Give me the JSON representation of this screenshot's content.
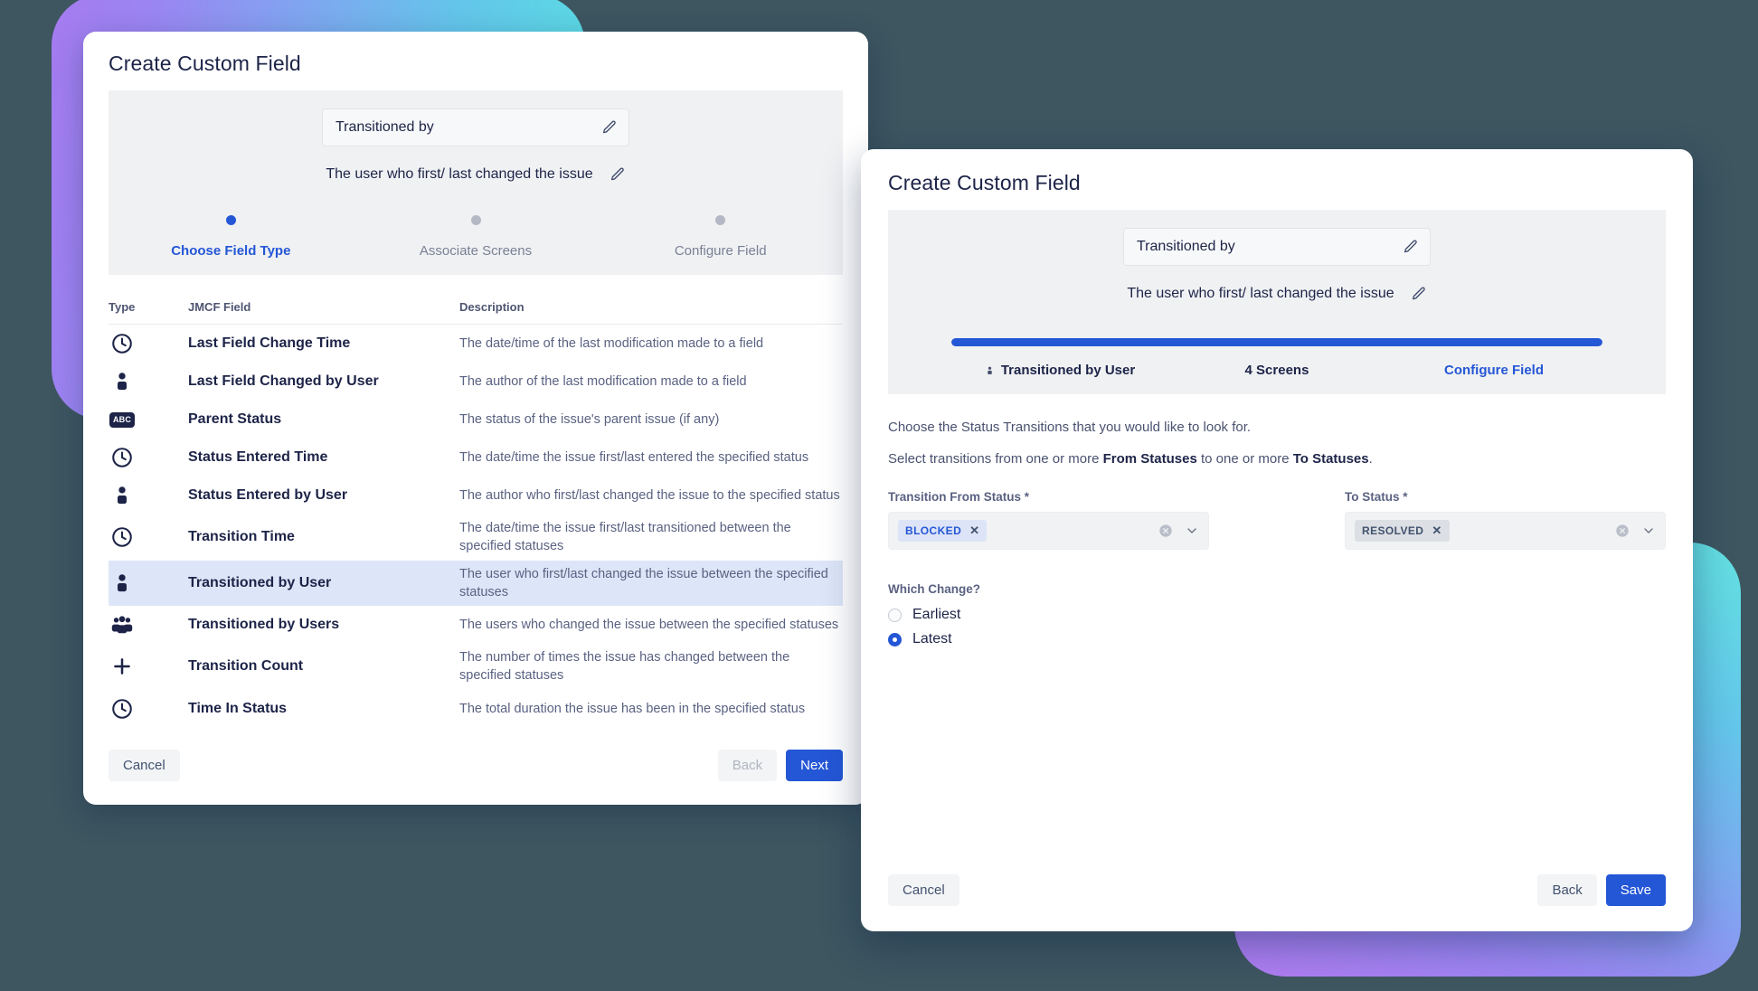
{
  "left_dialog": {
    "title": "Create Custom Field",
    "field_name": {
      "value": "Transitioned by",
      "placeholder": "Field name",
      "edit_icon": "pencil-icon"
    },
    "field_description": {
      "value": "The user who first/ last changed the issue",
      "edit_icon": "pencil-icon"
    },
    "steps": [
      {
        "label": "Choose Field Type",
        "active": true
      },
      {
        "label": "Associate Screens",
        "active": false
      },
      {
        "label": "Configure Field",
        "active": false
      }
    ],
    "table": {
      "columns": [
        "Type",
        "JMCF Field",
        "Description"
      ],
      "rows": [
        {
          "icon": "clock-icon",
          "name": "Last Field Change Time",
          "description": "The date/time of the last modification made to a field",
          "selected": false
        },
        {
          "icon": "user-icon",
          "name": "Last Field Changed by User",
          "description": "The author of the last modification made to a field",
          "selected": false
        },
        {
          "icon": "abc-icon",
          "name": "Parent Status",
          "description": "The status of the issue's parent issue (if any)",
          "selected": false
        },
        {
          "icon": "clock-icon",
          "name": "Status Entered Time",
          "description": "The date/time the issue first/last entered the specified status",
          "selected": false
        },
        {
          "icon": "user-icon",
          "name": "Status Entered by User",
          "description": "The author who first/last changed the issue to the specified status",
          "selected": false
        },
        {
          "icon": "clock-icon",
          "name": "Transition Time",
          "description": "The date/time the issue first/last transitioned between the specified statuses",
          "selected": false
        },
        {
          "icon": "user-icon",
          "name": "Transitioned by User",
          "description": "The user who first/last changed the issue between the specified statuses",
          "selected": true
        },
        {
          "icon": "users-icon",
          "name": "Transitioned by Users",
          "description": "The users who changed the issue between the specified statuses",
          "selected": false
        },
        {
          "icon": "plus-icon",
          "name": "Transition Count",
          "description": "The number of times the issue has changed between the specified statuses",
          "selected": false
        },
        {
          "icon": "clock-icon",
          "name": "Time In Status",
          "description": "The total duration the issue has been in the specified status",
          "selected": false
        }
      ]
    },
    "footer": {
      "cancel": "Cancel",
      "back": "Back",
      "next": "Next"
    }
  },
  "right_dialog": {
    "title": "Create Custom Field",
    "field_name": {
      "value": "Transitioned by",
      "placeholder": "Field name",
      "edit_icon": "pencil-icon"
    },
    "field_description": {
      "value": "The user who first/ last changed the issue",
      "edit_icon": "pencil-icon"
    },
    "progress": {
      "percent": 100,
      "steps": [
        {
          "label": "Transitioned by User",
          "icon": "user-icon",
          "state": "done"
        },
        {
          "label": "4 Screens",
          "icon": "",
          "state": "done"
        },
        {
          "label": "Configure Field",
          "icon": "",
          "state": "current"
        }
      ]
    },
    "instructions": {
      "line1": "Choose the Status Transitions that you would like to look for.",
      "line2_pre": "Select transitions from one or more ",
      "line2_b1": "From Statuses",
      "line2_mid": " to one or more ",
      "line2_b2": "To Statuses",
      "line2_post": "."
    },
    "from_status": {
      "label": "Transition From Status",
      "required_mark": "*",
      "chips": [
        {
          "text": "BLOCKED",
          "style": "blue",
          "remove": "✕"
        }
      ],
      "clear_icon": "clear-circle-icon",
      "caret_icon": "chevron-down-icon"
    },
    "to_status": {
      "label": "To Status",
      "required_mark": "*",
      "chips": [
        {
          "text": "RESOLVED",
          "style": "grey",
          "remove": "✕"
        }
      ],
      "clear_icon": "clear-circle-icon",
      "caret_icon": "chevron-down-icon"
    },
    "which_change": {
      "label": "Which Change?",
      "options": [
        {
          "label": "Earliest",
          "selected": false
        },
        {
          "label": "Latest",
          "selected": true
        }
      ]
    },
    "footer": {
      "cancel": "Cancel",
      "back": "Back",
      "save": "Save"
    }
  },
  "colors": {
    "accent_blue": "#2457d6",
    "selected_row": "#dde6f8",
    "band_grey": "#f0f1f3",
    "page_background": "#3d5660",
    "chip_blue_bg": "#dde4f7",
    "chip_grey_bg": "#dcdfe4"
  }
}
